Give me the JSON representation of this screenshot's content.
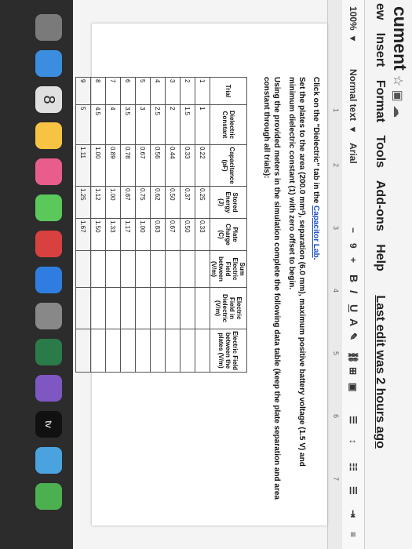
{
  "doc": {
    "title": "cument"
  },
  "menu": {
    "items": [
      "ew",
      "Insert",
      "Format",
      "Tools",
      "Add-ons",
      "Help"
    ],
    "last_edit": "Last edit was 2 hours ago"
  },
  "toolbar": {
    "zoom": "100%",
    "style": "Normal text",
    "font": "Arial",
    "size": "9",
    "bold": "B",
    "italic": "I",
    "underline": "U",
    "color": "A"
  },
  "ruler": {
    "marks": [
      "1",
      "2",
      "3",
      "4",
      "5",
      "6",
      "7"
    ]
  },
  "content": {
    "line1_prefix": "Click on the \"Dielectric\" tab in the ",
    "line1_link": "Capacitor Lab",
    "line2": "Set the plates to the area (200.0 mm²), separation (6.0 mm), maximum positive battery voltage (1.5 V) and minimum dielectric constant (1) with zero offset to begin.",
    "line3": "Using the provided meters in the simulation complete the following data table (keep the plate separation and area constant through all trials):"
  },
  "table": {
    "headers": [
      "Trial",
      "Dielectric Constant",
      "Capacitance (pF)",
      "Stored Energy (J)",
      "Plate Charge (C)",
      "Sum Electric Field between (V/m)",
      "Electric Field in Dielectric (V/m)",
      "Electric Field between the plates (V/m)"
    ],
    "rows": [
      [
        "1",
        "1",
        "0.22",
        "0.25",
        "0.33",
        "",
        "",
        ""
      ],
      [
        "2",
        "1.5",
        "0.33",
        "0.37",
        "0.50",
        "",
        "",
        ""
      ],
      [
        "3",
        "2",
        "0.44",
        "0.50",
        "0.67",
        "",
        "",
        ""
      ],
      [
        "4",
        "2.5",
        "0.56",
        "0.62",
        "0.83",
        "",
        "",
        ""
      ],
      [
        "5",
        "3",
        "0.67",
        "0.75",
        "1.00",
        "",
        "",
        ""
      ],
      [
        "6",
        "3.5",
        "0.78",
        "0.87",
        "1.17",
        "",
        "",
        ""
      ],
      [
        "7",
        "4",
        "0.89",
        "1.00",
        "1.33",
        "",
        "",
        ""
      ],
      [
        "8",
        "4.5",
        "1.00",
        "1.12",
        "1.50",
        "",
        "",
        ""
      ],
      [
        "9",
        "5",
        "1.11",
        "1.25",
        "1.67",
        "",
        "",
        ""
      ]
    ]
  },
  "dock": {
    "calendar_day": "8",
    "tv_label": "tv"
  }
}
